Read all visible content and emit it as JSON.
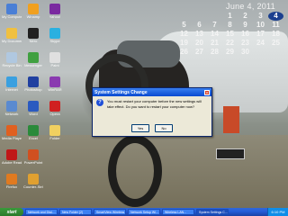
{
  "calendar": {
    "title": "June 4, 2011",
    "weekdays": [
      "S",
      "M",
      "T",
      "W",
      "T",
      "F",
      "S"
    ],
    "rows": [
      [
        "",
        "",
        "",
        "1",
        "2",
        "3",
        "4"
      ],
      [
        "5",
        "6",
        "7",
        "8",
        "9",
        "10",
        "11"
      ],
      [
        "12",
        "13",
        "14",
        "15",
        "16",
        "17",
        "18"
      ],
      [
        "19",
        "20",
        "21",
        "22",
        "23",
        "24",
        "25"
      ],
      [
        "26",
        "27",
        "28",
        "29",
        "30",
        "",
        ""
      ]
    ],
    "today": "4"
  },
  "desktop_icons": [
    {
      "label": "My Computer",
      "color": "#4a7fd6"
    },
    {
      "label": "My Documents",
      "color": "#f0c040"
    },
    {
      "label": "Recycle Bin",
      "color": "#b0c8e0"
    },
    {
      "label": "Internet",
      "color": "#3aa0e0"
    },
    {
      "label": "Network",
      "color": "#5a8ad0"
    },
    {
      "label": "Media Player",
      "color": "#e06020"
    },
    {
      "label": "Adobe Reader",
      "color": "#c01818"
    },
    {
      "label": "Firefox",
      "color": "#e07a20"
    },
    {
      "label": "Winamp",
      "color": "#f0a020"
    },
    {
      "label": "Nero",
      "color": "#202020"
    },
    {
      "label": "Messenger",
      "color": "#40a040"
    },
    {
      "label": "Photoshop",
      "color": "#2040a0"
    },
    {
      "label": "Word",
      "color": "#2a5ac0"
    },
    {
      "label": "Excel",
      "color": "#2a8a3a"
    },
    {
      "label": "PowerPoint",
      "color": "#d05020"
    },
    {
      "label": "Counter-Strike",
      "color": "#e0a030"
    },
    {
      "label": "Yahoo!",
      "color": "#7a2aa0"
    },
    {
      "label": "Skype",
      "color": "#2ab0e0"
    },
    {
      "label": "Paint",
      "color": "#e0e0e0"
    },
    {
      "label": "WinRAR",
      "color": "#8a3ab0"
    },
    {
      "label": "Opera",
      "color": "#d02020"
    },
    {
      "label": "Folder",
      "color": "#f0d060"
    }
  ],
  "dialog": {
    "title": "System Settings Change",
    "message": "You must restart your computer before the new settings will take effect. Do you want to restart your computer now?",
    "yes_label": "Yes",
    "no_label": "No"
  },
  "taskbar": {
    "start_label": "start",
    "tasks": [
      "Network and Dial-...",
      "New Folder (2)",
      "SmartView Wireless",
      "Network Setup Wi...",
      "Wireless LAN...",
      "System Settings C..."
    ],
    "clock": "6:10 PM"
  }
}
